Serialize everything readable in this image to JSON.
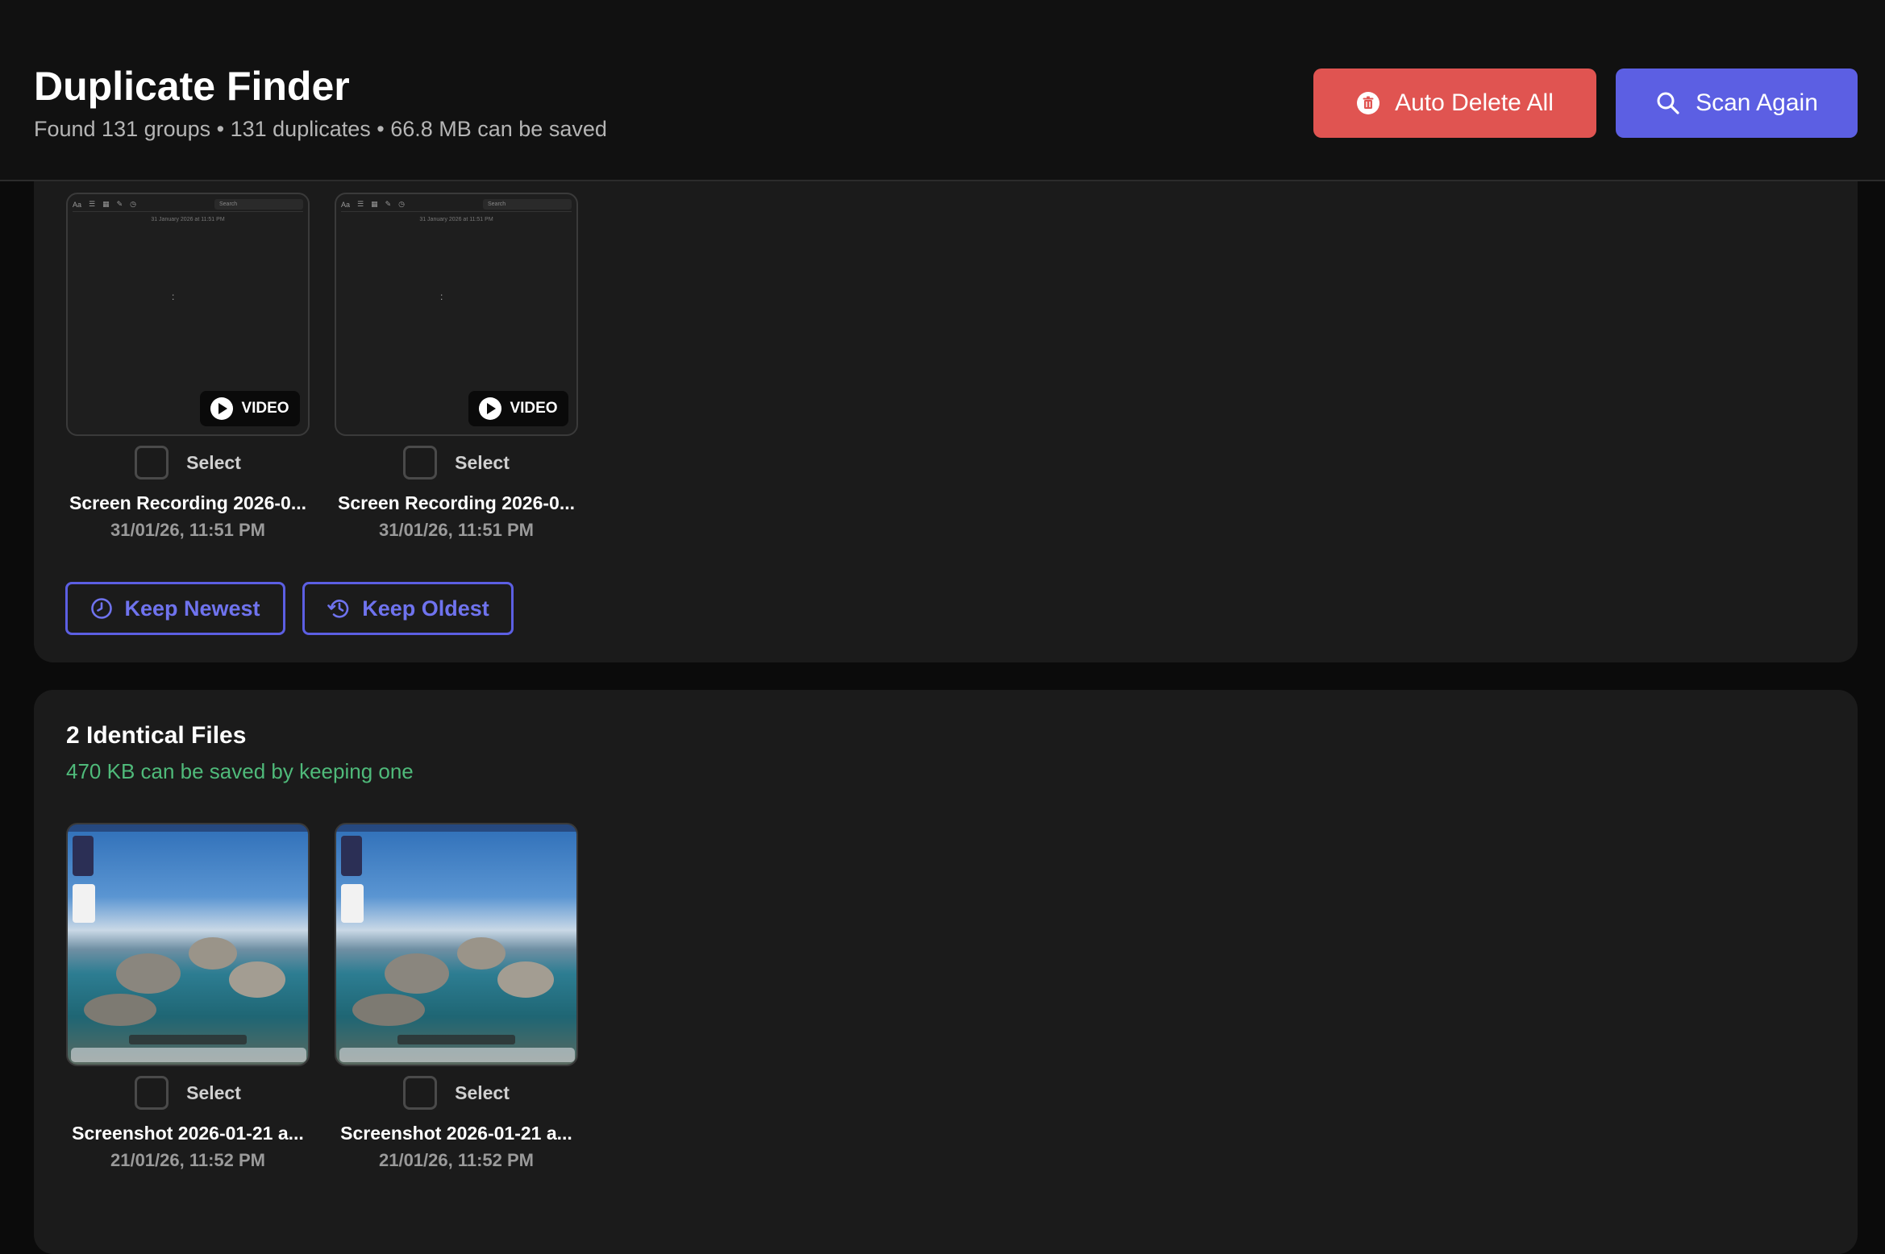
{
  "header": {
    "title": "Duplicate Finder",
    "subtitle": "Found 131 groups • 131 duplicates • 66.8 MB can be saved",
    "auto_delete_label": "Auto Delete All",
    "scan_again_label": "Scan Again"
  },
  "groups": [
    {
      "files": [
        {
          "name": "Screen Recording 2026-0...",
          "date": "31/01/26, 11:51 PM",
          "badge": "VIDEO",
          "select_label": "Select",
          "thumb": {
            "search": "Search",
            "date": "31 January 2026 at 11:51 PM",
            "mark": ":"
          }
        },
        {
          "name": "Screen Recording 2026-0...",
          "date": "31/01/26, 11:51 PM",
          "badge": "VIDEO",
          "select_label": "Select",
          "thumb": {
            "search": "Search",
            "date": "31 January 2026 at 11:51 PM",
            "mark": ":"
          }
        }
      ],
      "keep_newest_label": "Keep Newest",
      "keep_oldest_label": "Keep Oldest"
    },
    {
      "title": "2 Identical Files",
      "subtitle": "470 KB can be saved by keeping one",
      "files": [
        {
          "name": "Screenshot 2026-01-21 a...",
          "date": "21/01/26, 11:52 PM",
          "select_label": "Select"
        },
        {
          "name": "Screenshot 2026-01-21 a...",
          "date": "21/01/26, 11:52 PM",
          "select_label": "Select"
        }
      ]
    }
  ],
  "colors": {
    "danger": "#e05451",
    "accent": "#5c5fe3",
    "savings": "#4fba7a",
    "background": "#0b0b0b",
    "card": "#1b1b1b"
  },
  "icons": {
    "auto_delete": "trash-icon",
    "scan_again": "search-icon",
    "video_badge": "play-icon",
    "keep_newest": "clock-icon",
    "keep_oldest": "history-icon"
  }
}
